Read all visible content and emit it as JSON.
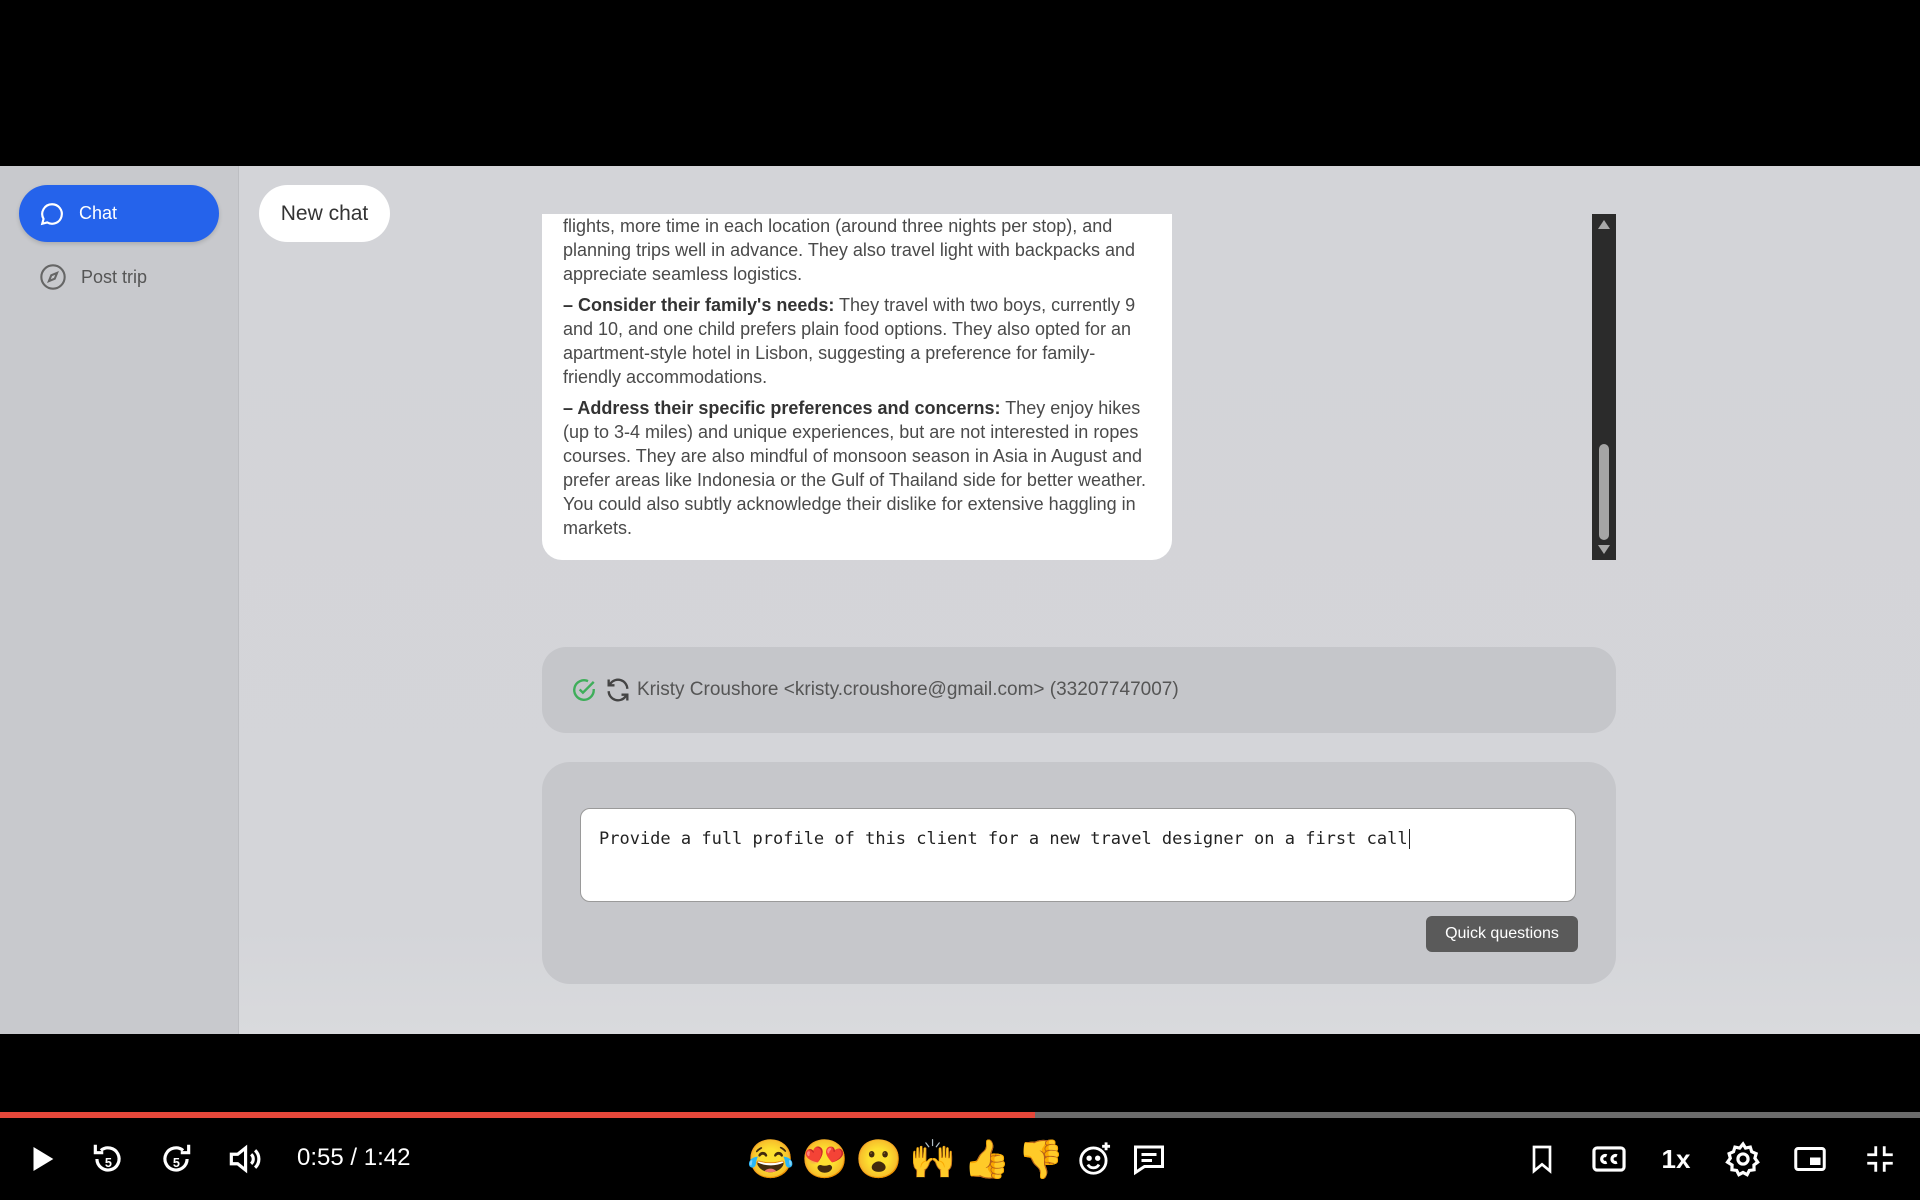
{
  "sidebar": {
    "items": [
      {
        "label": "Chat",
        "icon": "chat-bubble-icon",
        "active": true
      },
      {
        "label": "Post trip",
        "icon": "compass-icon",
        "active": false
      }
    ]
  },
  "header": {
    "new_chat_label": "New chat"
  },
  "message": {
    "intro_text": "flights, more time in each location (around three nights per stop), and planning trips well in advance. They also travel light with backpacks and appreciate seamless logistics.",
    "bullets": [
      {
        "prefix": "– ",
        "heading": "Consider their family's needs:",
        "text": " They travel with two boys, currently 9 and 10, and one child prefers plain food options. They also opted for an apartment-style hotel in Lisbon, suggesting a preference for family-friendly accommodations."
      },
      {
        "prefix": "– ",
        "heading": "Address their specific preferences and concerns:",
        "text": " They enjoy hikes (up to 3-4 miles) and unique experiences, but are not interested in ropes courses. They are also mindful of monsoon season in Asia in August and prefer areas like Indonesia or the Gulf of Thailand side for better weather. You could also subtly acknowledge their dislike for extensive haggling in markets."
      }
    ]
  },
  "client": {
    "text": "Kristy Croushore <kristy.croushore@gmail.com> (33207747007)"
  },
  "composer": {
    "input_value": "Provide a full profile of this client for a new travel designer on a first call",
    "quick_label": "Quick questions"
  },
  "player": {
    "time_label": "0:55 / 1:42",
    "progress_fraction": 0.539,
    "speed_label": "1x",
    "reactions": [
      "😂",
      "😍",
      "😮",
      "🙌",
      "👍",
      "👎"
    ],
    "colors": {
      "progress": "#e5473a",
      "accent": "#2563eb"
    }
  }
}
